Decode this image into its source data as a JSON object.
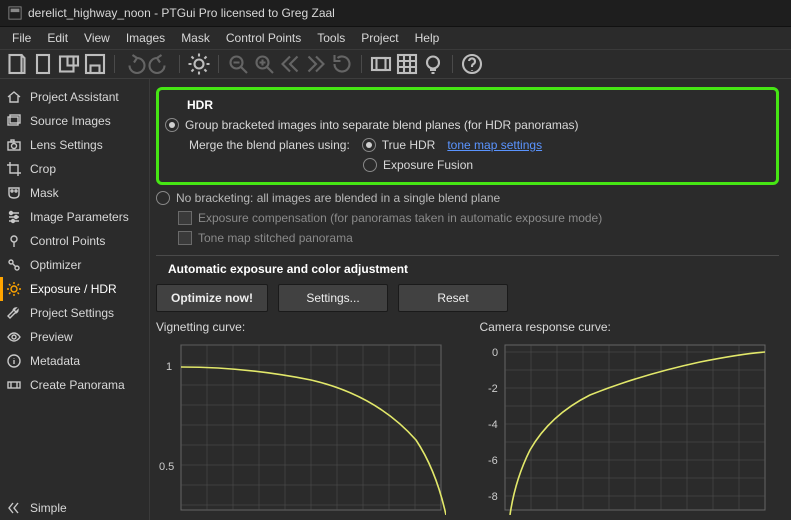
{
  "window": {
    "title": "derelict_highway_noon - PTGui Pro licensed to Greg Zaal"
  },
  "menu": {
    "file": "File",
    "edit": "Edit",
    "view": "View",
    "images": "Images",
    "mask": "Mask",
    "control_points": "Control Points",
    "tools": "Tools",
    "project": "Project",
    "help": "Help"
  },
  "sidebar": {
    "project_assistant": "Project Assistant",
    "source_images": "Source Images",
    "lens_settings": "Lens Settings",
    "crop": "Crop",
    "mask": "Mask",
    "image_parameters": "Image Parameters",
    "control_points": "Control Points",
    "optimizer": "Optimizer",
    "exposure_hdr": "Exposure / HDR",
    "project_settings": "Project Settings",
    "preview": "Preview",
    "metadata": "Metadata",
    "create_panorama": "Create Panorama",
    "simple": "Simple"
  },
  "hdr": {
    "title": "HDR",
    "group_label": "Group bracketed images into separate blend planes (for HDR panoramas)",
    "merge_label": "Merge the blend planes using:",
    "true_hdr": "True HDR",
    "tone_map_link": "tone map settings",
    "exposure_fusion": "Exposure Fusion",
    "no_bracketing": "No bracketing: all images are blended in a single blend plane",
    "exposure_compensation": "Exposure compensation (for panoramas taken in automatic exposure mode)",
    "tone_map_stitched": "Tone map stitched panorama"
  },
  "auto": {
    "title": "Automatic exposure and color adjustment",
    "optimize": "Optimize now!",
    "settings": "Settings...",
    "reset": "Reset"
  },
  "charts": {
    "vignetting": "Vignetting curve:",
    "camera": "Camera response curve:"
  },
  "chart_data": [
    {
      "type": "line",
      "title": "Vignetting curve",
      "xlabel": "",
      "ylabel": "",
      "xlim": [
        0,
        1
      ],
      "ylim": [
        0.3,
        1.05
      ],
      "y_ticks": [
        0.5,
        1
      ],
      "series": [
        {
          "name": "vignetting",
          "x": [
            0,
            0.1,
            0.2,
            0.3,
            0.4,
            0.5,
            0.6,
            0.7,
            0.8,
            0.9,
            1.0
          ],
          "y": [
            1.0,
            0.995,
            0.99,
            0.98,
            0.965,
            0.94,
            0.9,
            0.84,
            0.76,
            0.64,
            0.43
          ]
        }
      ]
    },
    {
      "type": "line",
      "title": "Camera response curve",
      "xlabel": "",
      "ylabel": "",
      "xlim": [
        0,
        1
      ],
      "ylim": [
        -10,
        0.5
      ],
      "y_ticks": [
        0,
        -2,
        -4,
        -6,
        -8
      ],
      "series": [
        {
          "name": "response",
          "x": [
            0.02,
            0.05,
            0.1,
            0.15,
            0.2,
            0.3,
            0.4,
            0.5,
            0.6,
            0.7,
            0.8,
            0.9,
            1.0
          ],
          "y": [
            -10,
            -8.5,
            -6.8,
            -5.6,
            -4.8,
            -3.6,
            -2.8,
            -2.1,
            -1.5,
            -1.0,
            -0.6,
            -0.25,
            0.0
          ]
        }
      ]
    }
  ]
}
